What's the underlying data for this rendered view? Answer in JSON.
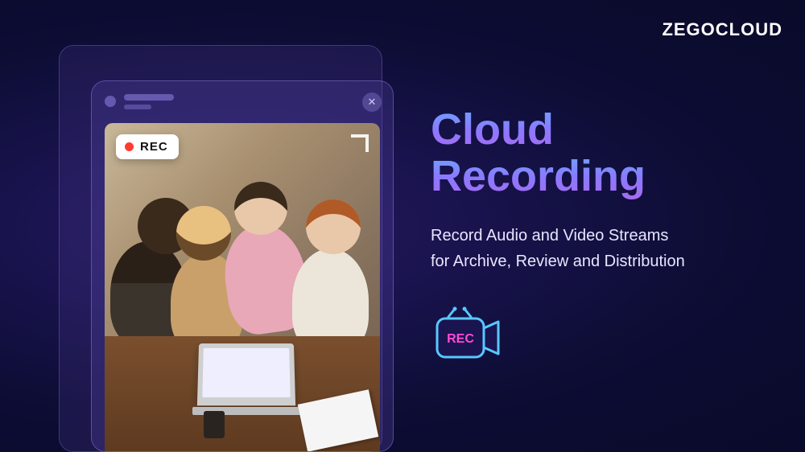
{
  "brand": {
    "logo_text": "ZEGOCLOUD"
  },
  "hero": {
    "title_line1": "Cloud",
    "title_line2": "Recording",
    "subtitle_line1": "Record Audio and Video Streams",
    "subtitle_line2": "for Archive, Review and Distribution"
  },
  "card": {
    "rec_label": "REC",
    "close_glyph": "✕"
  },
  "icon": {
    "rec_text": "REC"
  },
  "colors": {
    "title_gradient_start": "#6aa8ff",
    "title_gradient_end": "#a86af0",
    "rec_red": "#ff3b30"
  }
}
